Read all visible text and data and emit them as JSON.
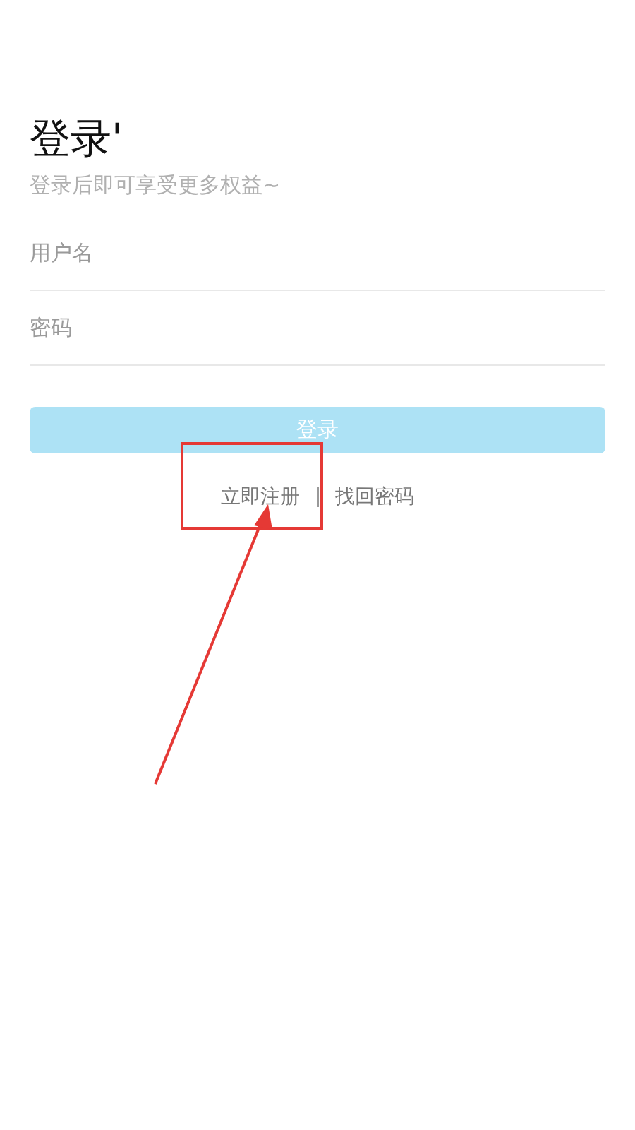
{
  "title": "登录'",
  "subtitle": "登录后即可享受更多权益~",
  "fields": [
    {
      "placeholder": "用户名"
    },
    {
      "placeholder": "密码"
    }
  ],
  "login_button": {
    "label": "登录",
    "disabled": true
  },
  "links": [
    {
      "label": "立即注册"
    },
    {
      "label": "找回密码"
    }
  ]
}
